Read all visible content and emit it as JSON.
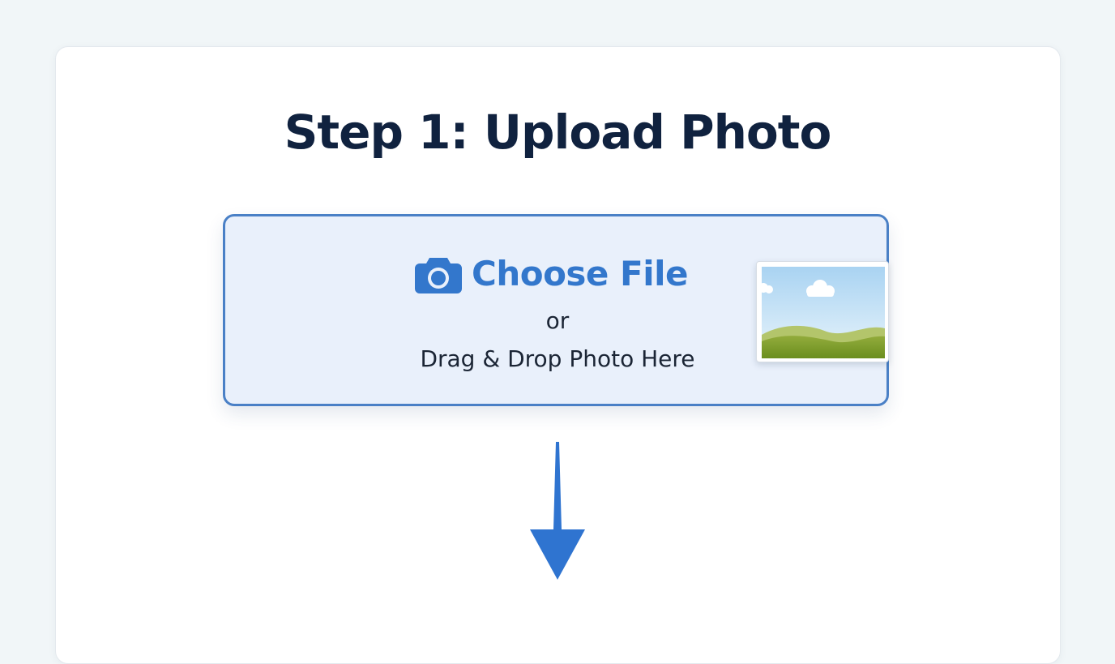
{
  "page": {
    "title": "Step 1: Upload Photo"
  },
  "upload": {
    "choose_label": "Choose File",
    "or_label": "or",
    "drop_label": "Drag & Drop Photo Here",
    "camera_icon": "camera-icon",
    "preview_icon": "landscape-image-icon",
    "direction_icon": "arrow-down-icon"
  },
  "colors": {
    "background": "#f1f6f8",
    "card": "#ffffff",
    "title": "#10223f",
    "accent": "#3377cc",
    "dropzone_border": "#4a80c6",
    "dropzone_fill": "#e9f0fb",
    "text": "#1b2535"
  }
}
